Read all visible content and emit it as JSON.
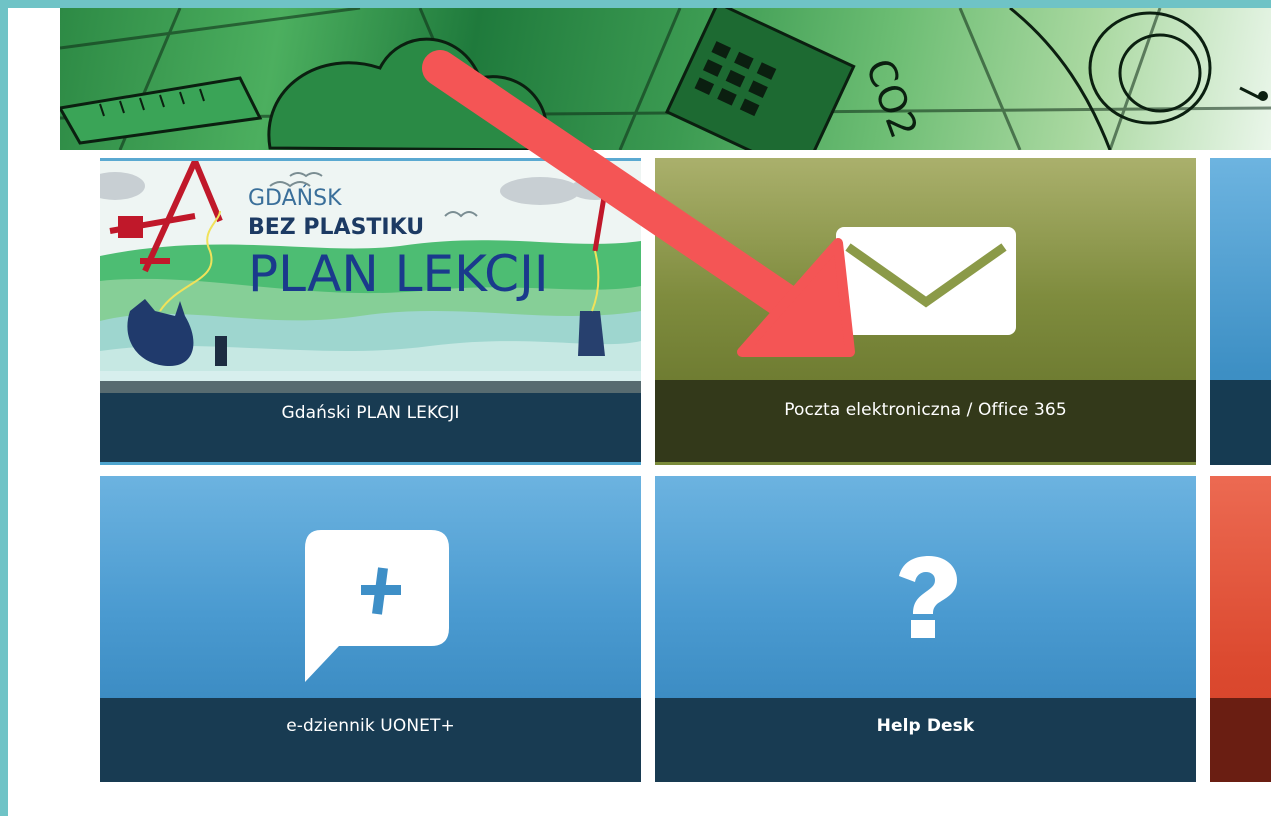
{
  "banner": {
    "icon": "educational-doodle-banner"
  },
  "tiles": {
    "plan": {
      "caption": "Gdański PLAN LEKCJI",
      "image": {
        "city": "GDAŃSK",
        "slogan": "BEZ PLASTIKU",
        "title": "PLAN LEKCJI"
      }
    },
    "mail": {
      "caption": "Poczta elektroniczna / Office 365",
      "icon": "envelope-icon"
    },
    "uonet": {
      "caption": "e-dziennik UONET+",
      "icon": "chat-plus-icon"
    },
    "help": {
      "caption": "Help Desk",
      "icon": "question-mark-icon"
    }
  },
  "annotation": {
    "icon": "red-arrow-icon",
    "color": "#f45555"
  },
  "colors": {
    "frame": "#6fc3c6",
    "caption_dark_blue": "#183b52",
    "caption_dark_olive": "#33391a",
    "tile_blue": "#4a9ad0",
    "tile_olive": "#7f8c3e",
    "tile_red": "#dc4a30"
  }
}
